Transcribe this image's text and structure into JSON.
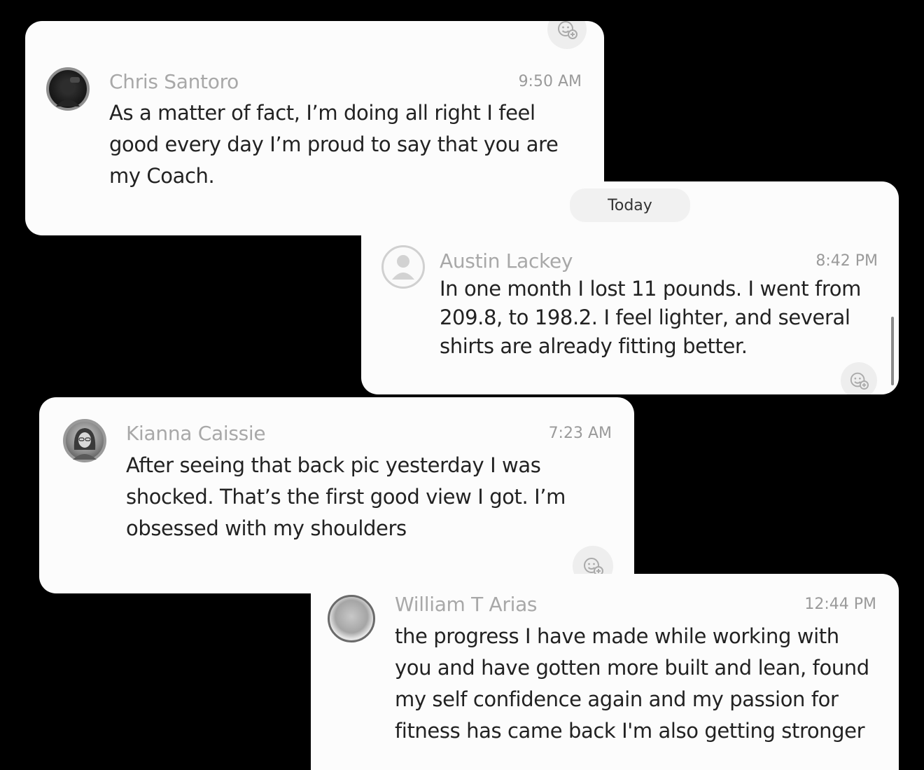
{
  "separator": {
    "label": "Today"
  },
  "messages": [
    {
      "name": "Chris Santoro",
      "time": "9:50 AM",
      "text": "As a matter of fact, I’m doing all right I feel good every day I’m proud to say that you are my Coach.",
      "avatar": "user-photo-avatar"
    },
    {
      "name": "Austin Lackey",
      "time": "8:42 PM",
      "text": "In one month I lost 11 pounds. I went from 209.8, to 198.2. I feel lighter, and several shirts are already fitting better.",
      "avatar": "default-user-icon"
    },
    {
      "name": "Kianna Caissie",
      "time": "7:23 AM",
      "text": "After seeing that back pic yesterday I was shocked. That’s the first good view I got. I’m obsessed with my shoulders",
      "avatar": "user-photo-avatar"
    },
    {
      "name": "William T Arias",
      "time": "12:44 PM",
      "text": "the progress I have made while working with you and have gotten more built and lean, found my self confidence again and my passion for fitness has came back I'm also getting stronger",
      "avatar": "user-photo-avatar"
    }
  ],
  "icons": {
    "reaction": "add-reaction-icon"
  }
}
